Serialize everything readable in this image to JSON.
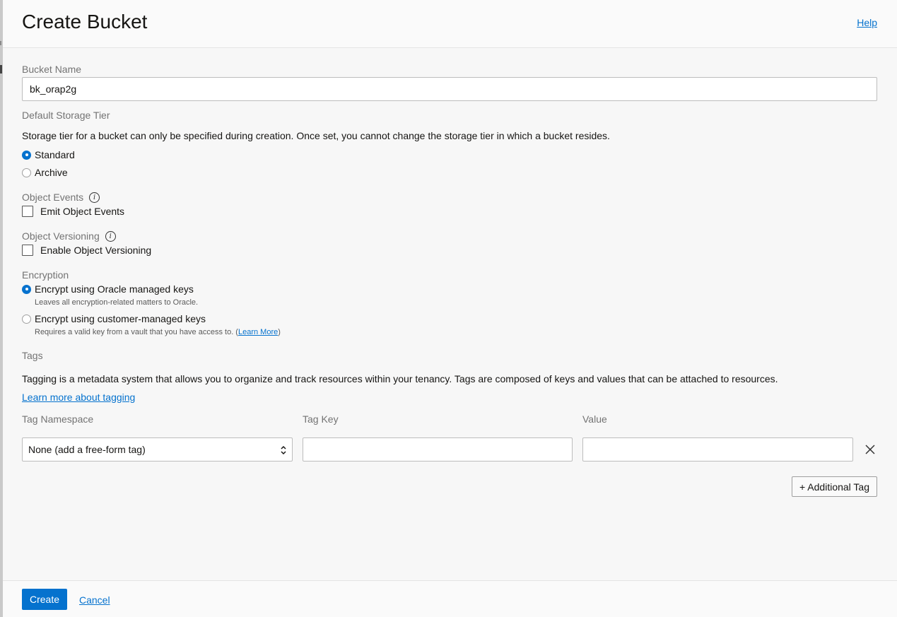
{
  "header": {
    "title": "Create Bucket",
    "help_label": "Help"
  },
  "bucket_name": {
    "label": "Bucket Name",
    "value": "bk_orap2g"
  },
  "storage_tier": {
    "label": "Default Storage Tier",
    "description": "Storage tier for a bucket can only be specified during creation. Once set, you cannot change the storage tier in which a bucket resides.",
    "options": [
      {
        "label": "Standard",
        "selected": true
      },
      {
        "label": "Archive",
        "selected": false
      }
    ]
  },
  "object_events": {
    "label": "Object Events",
    "checkbox_label": "Emit Object Events",
    "checked": false
  },
  "object_versioning": {
    "label": "Object Versioning",
    "checkbox_label": "Enable Object Versioning",
    "checked": false
  },
  "encryption": {
    "label": "Encryption",
    "options": [
      {
        "label": "Encrypt using Oracle managed keys",
        "note": "Leaves all encryption-related matters to Oracle.",
        "selected": true
      },
      {
        "label": "Encrypt using customer-managed keys",
        "note": "Requires a valid key from a vault that you have access to. (",
        "note_link": "Learn More",
        "note_suffix": ")",
        "selected": false
      }
    ]
  },
  "tags": {
    "label": "Tags",
    "description": "Tagging is a metadata system that allows you to organize and track resources within your tenancy. Tags are composed of keys and values that can be attached to resources.",
    "learn_more": "Learn more about tagging",
    "columns": {
      "namespace": "Tag Namespace",
      "key": "Tag Key",
      "value": "Value"
    },
    "row": {
      "namespace": "None (add a free-form tag)",
      "key": "",
      "value": ""
    },
    "add_label": "+ Additional Tag"
  },
  "footer": {
    "create_label": "Create",
    "cancel_label": "Cancel"
  },
  "colors": {
    "accent": "#0572ce",
    "background": "#f7f7f7"
  },
  "icons": {
    "info": "info-icon",
    "remove": "close-icon",
    "select": "chevron-up-down-icon"
  }
}
